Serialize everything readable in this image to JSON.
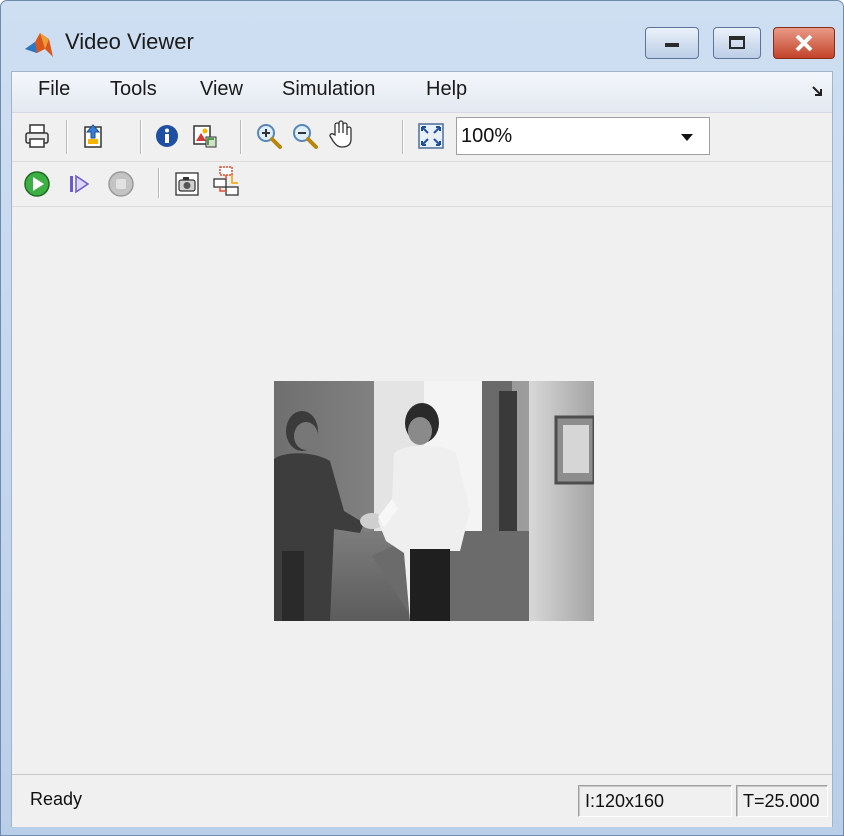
{
  "window": {
    "title": "Video Viewer"
  },
  "menu": {
    "items": [
      "File",
      "Tools",
      "View",
      "Simulation",
      "Help"
    ],
    "dock_icon": "undock-arrow-icon"
  },
  "toolbar1": {
    "buttons": [
      "print-icon",
      "open-file-icon",
      "info-icon",
      "export-image-icon",
      "zoom-in-icon",
      "zoom-out-icon",
      "pan-hand-icon",
      "fit-to-view-icon"
    ],
    "zoom_value": "100%"
  },
  "toolbar2": {
    "buttons": [
      "play-icon",
      "step-forward-icon",
      "stop-icon",
      "snapshot-camera-icon",
      "highlight-simulink-signal-icon"
    ]
  },
  "status": {
    "text": "Ready",
    "image_size": "I:120x160",
    "time": "T=25.000"
  },
  "colors": {
    "play_green": "#2ea52e",
    "close_red": "#c3432a"
  }
}
